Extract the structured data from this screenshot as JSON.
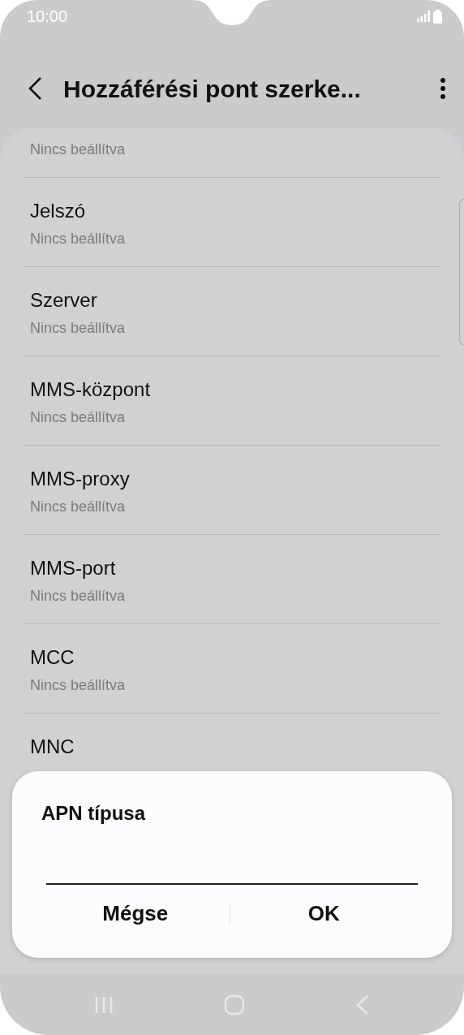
{
  "status_bar": {
    "time": "10:00"
  },
  "header": {
    "title": "Hozzáférési pont szerke..."
  },
  "fields": [
    {
      "value": "Nincs beállítva"
    },
    {
      "title": "Jelszó",
      "value": "Nincs beállítva"
    },
    {
      "title": "Szerver",
      "value": "Nincs beállítva"
    },
    {
      "title": "MMS-központ",
      "value": "Nincs beállítva"
    },
    {
      "title": "MMS-proxy",
      "value": "Nincs beállítva"
    },
    {
      "title": "MMS-port",
      "value": "Nincs beállítva"
    },
    {
      "title": "MCC",
      "value": "Nincs beállítva"
    },
    {
      "title": "MNC"
    }
  ],
  "dialog": {
    "title": "APN típusa",
    "buttons": [
      "Mégse",
      "OK"
    ]
  }
}
